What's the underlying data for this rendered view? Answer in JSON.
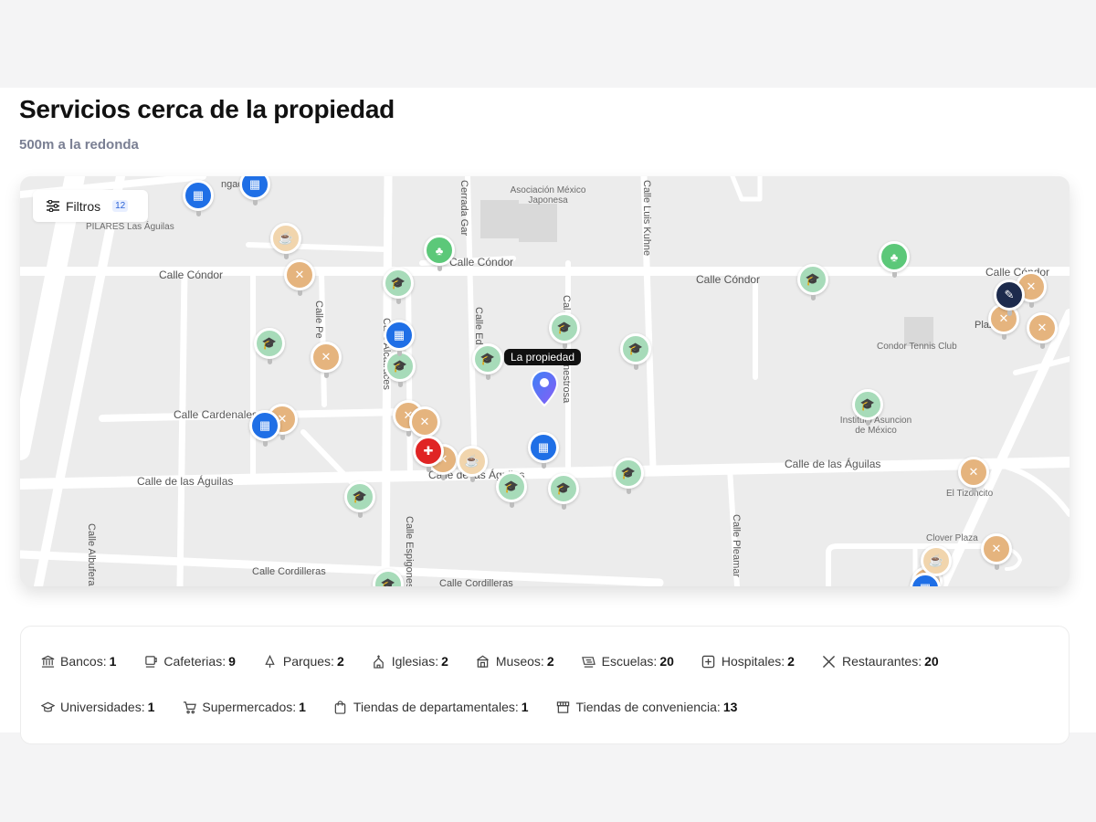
{
  "header": {
    "title": "Servicios cerca de la propiedad",
    "subtitle": "500m a la redonda"
  },
  "map": {
    "filter_button": {
      "label": "Filtros",
      "count": "12"
    },
    "property_label": "La propiedad",
    "street_labels": {
      "condor_w": "Calle Cóndor",
      "condor_c": "Calle Cóndor",
      "condor_e": "Calle Cóndor",
      "condor_ne": "Calle Cóndor",
      "cardenales": "Calle Cardenales",
      "aguilas_w": "Calle de las Águilas",
      "aguilas_c": "Calle de las Águilas",
      "aguilas_e": "Calle de las Águilas",
      "cordilleras_w": "Calle Cordilleras",
      "cordilleras_c": "Calle Cordilleras",
      "cerrada_gar": "Cerrada Gar",
      "luis_kuhne": "Calle Luis Kuhne",
      "calle_pe": "Calle Pe",
      "alcatraces": "Calle Alcatraces",
      "calle_ed": "Calle Ed",
      "cal": "Cal",
      "nestrosa": "nestrosa",
      "espigones": "Calle Espigones",
      "albuferas": "Calle Albuferas",
      "pleamar": "Calle Pleamar",
      "condor_partial": "Calle Cóndor",
      "plaza": "Plaza",
      "ngad": "ngad"
    },
    "poi_labels": {
      "pilares": "PILARES Las Águilas",
      "asociacion": "Asociación México Japonesa",
      "condor_tennis": "Condor Tennis Club",
      "instituto": "Instituto Asuncion de México",
      "tizoncito": "El Tizoncito",
      "clover": "Clover Plaza"
    }
  },
  "legend": {
    "row1": [
      {
        "icon": "bank-icon",
        "label": "Bancos:",
        "count": "1"
      },
      {
        "icon": "coffee-icon",
        "label": "Cafeterias:",
        "count": "9"
      },
      {
        "icon": "tree-icon",
        "label": "Parques:",
        "count": "2"
      },
      {
        "icon": "church-icon",
        "label": "Iglesias:",
        "count": "2"
      },
      {
        "icon": "museum-icon",
        "label": "Museos:",
        "count": "2"
      },
      {
        "icon": "school-icon",
        "label": "Escuelas:",
        "count": "20"
      },
      {
        "icon": "hospital-icon",
        "label": "Hospitales:",
        "count": "2"
      },
      {
        "icon": "restaurant-icon",
        "label": "Restaurantes:",
        "count": "20"
      }
    ],
    "row2": [
      {
        "icon": "graduation-cap-icon",
        "label": "Universidades:",
        "count": "1"
      },
      {
        "icon": "cart-icon",
        "label": "Supermercados:",
        "count": "1"
      },
      {
        "icon": "shopping-bag-icon",
        "label": "Tiendas de departamentales:",
        "count": "1"
      },
      {
        "icon": "store-icon",
        "label": "Tiendas de conveniencia:",
        "count": "13"
      }
    ]
  },
  "colors": {
    "education": "#a7dbb9",
    "restaurant": "#e5b47e",
    "cafe": "#f1d5ad",
    "store": "#1f6fe6",
    "park": "#5cc879",
    "school": "#1d2b4d",
    "hospital": "#e02424"
  }
}
